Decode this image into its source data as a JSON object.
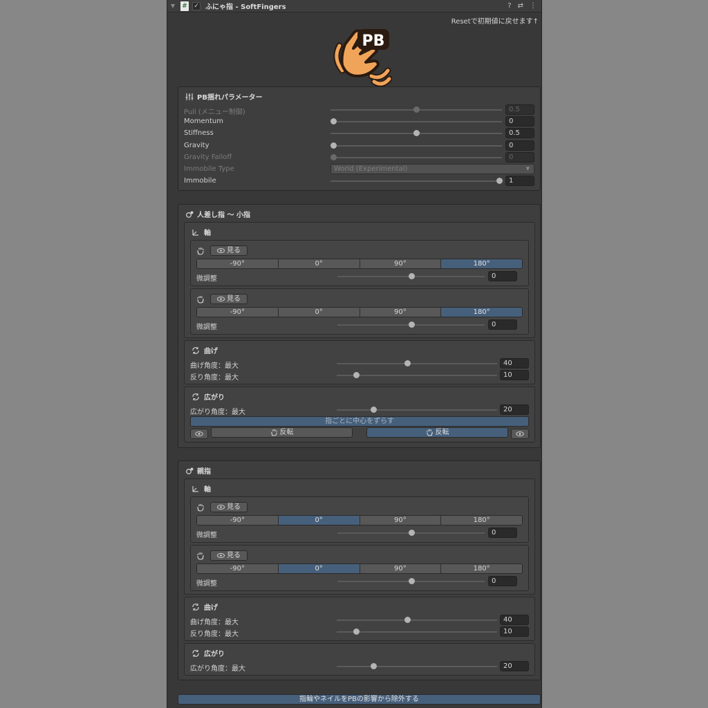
{
  "header": {
    "title": "ふにゃ指 - SoftFingers",
    "tools": [
      "?",
      "⇄",
      "⋮"
    ]
  },
  "reset_label": "Resetで初期値に戻せます↑",
  "logo": {
    "text": "PB",
    "colors": {
      "orange": "#f0a45a",
      "dark": "#2b1a10"
    }
  },
  "params": {
    "title": "PB揺れパラメーター",
    "rows": [
      {
        "label": "Pull (メニュー制御)",
        "value": "0.5",
        "level": 0.5,
        "enabled": false
      },
      {
        "label": "Momentum",
        "value": "0",
        "level": 0.0,
        "enabled": true
      },
      {
        "label": "Stiffness",
        "value": "0.5",
        "level": 0.5,
        "enabled": true
      },
      {
        "label": "Gravity",
        "value": "0",
        "level": 0.0,
        "enabled": true
      },
      {
        "label": "Gravity Falloff",
        "value": "0",
        "level": 0.0,
        "enabled": false
      }
    ],
    "immobile_type": {
      "label": "Immobile Type",
      "value": "World (Experimental)"
    },
    "immobile": {
      "label": "Immobile",
      "value": "1",
      "level": 1.0
    }
  },
  "sections": [
    {
      "title": "人差し指 〜 小指",
      "axis_title": "軸",
      "hands": [
        {
          "see_label": "見る",
          "options": [
            "-90°",
            "0°",
            "90°",
            "180°"
          ],
          "selected": 3,
          "fine_label": "微調整",
          "fine_value": "0",
          "fine_level": 0.5
        },
        {
          "see_label": "見る",
          "options": [
            "-90°",
            "0°",
            "90°",
            "180°"
          ],
          "selected": 3,
          "fine_label": "微調整",
          "fine_value": "0",
          "fine_level": 0.5
        }
      ],
      "bend": {
        "title": "曲げ",
        "rows": [
          {
            "label": "曲げ角度：最大",
            "value": "40",
            "level": 0.44
          },
          {
            "label": "反り角度：最大",
            "value": "10",
            "level": 0.12
          }
        ]
      },
      "spread": {
        "title": "広がり",
        "rows": [
          {
            "label": "広がり角度：最大",
            "value": "20",
            "level": 0.23
          }
        ],
        "shift_label": "指ごとに中心をずらす",
        "flip_left": "反転",
        "flip_right": "反転"
      }
    },
    {
      "title": "親指",
      "axis_title": "軸",
      "hands": [
        {
          "see_label": "見る",
          "options": [
            "-90°",
            "0°",
            "90°",
            "180°"
          ],
          "selected": 1,
          "fine_label": "微調整",
          "fine_value": "0",
          "fine_level": 0.5
        },
        {
          "see_label": "見る",
          "options": [
            "-90°",
            "0°",
            "90°",
            "180°"
          ],
          "selected": 1,
          "fine_label": "微調整",
          "fine_value": "0",
          "fine_level": 0.5
        }
      ],
      "bend": {
        "title": "曲げ",
        "rows": [
          {
            "label": "曲げ角度：最大",
            "value": "40",
            "level": 0.44
          },
          {
            "label": "反り角度：最大",
            "value": "10",
            "level": 0.12
          }
        ]
      },
      "spread": {
        "title": "広がり",
        "rows": [
          {
            "label": "広がり角度：最大",
            "value": "20",
            "level": 0.23
          }
        ]
      }
    }
  ],
  "bottom_button": "指輪やネイルをPBの影響から除外する",
  "colors": {
    "panel": "#383838",
    "selected": "#46607c",
    "backdrop": "#878787"
  }
}
